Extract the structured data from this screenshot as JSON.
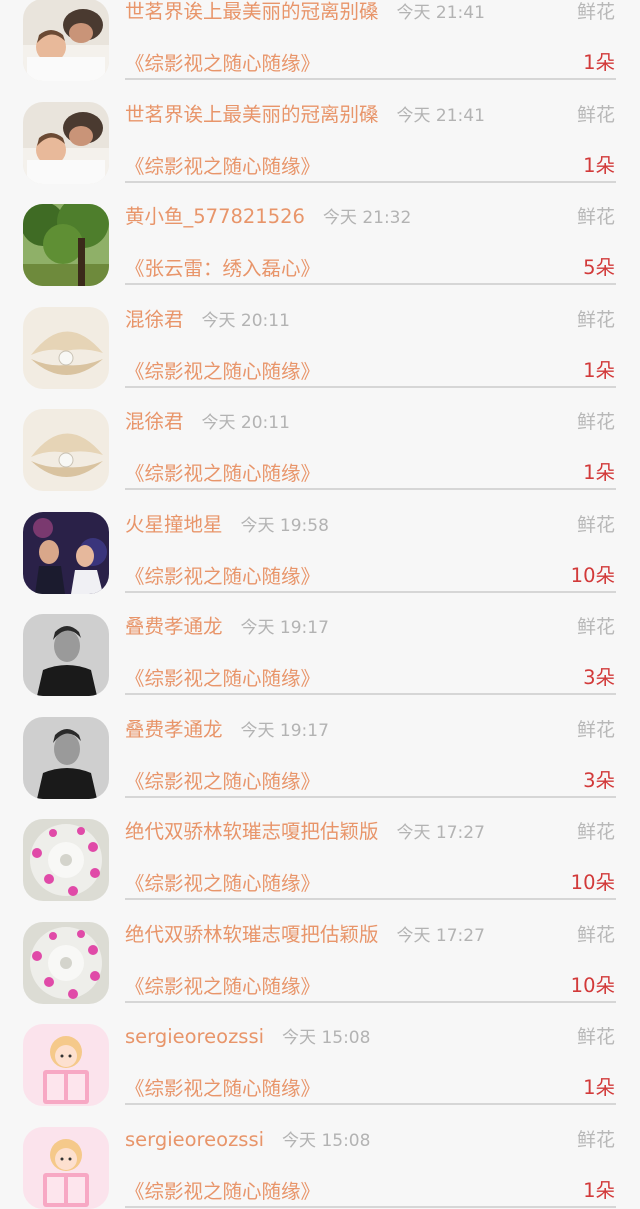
{
  "gifts": [
    {
      "user": "世茗界诶上最美丽的冠离别磉",
      "time": "今天 21:41",
      "gift": "鲜花",
      "book": "《综影视之随心随缘》",
      "count": "1朵",
      "avatar": "sleeping-baby-photo"
    },
    {
      "user": "世茗界诶上最美丽的冠离别磉",
      "time": "今天 21:41",
      "gift": "鲜花",
      "book": "《综影视之随心随缘》",
      "count": "1朵",
      "avatar": "sleeping-baby-photo"
    },
    {
      "user": "黄小鱼_577821526",
      "time": "今天 21:32",
      "gift": "鲜花",
      "book": "《张云雷：绣入磊心》",
      "count": "5朵",
      "avatar": "tree-photo"
    },
    {
      "user": "混徐君",
      "time": "今天 20:11",
      "gift": "鲜花",
      "book": "《综影视之随心随缘》",
      "count": "1朵",
      "avatar": "pearl-shell-photo"
    },
    {
      "user": "混徐君",
      "time": "今天 20:11",
      "gift": "鲜花",
      "book": "《综影视之随心随缘》",
      "count": "1朵",
      "avatar": "pearl-shell-photo"
    },
    {
      "user": "火星撞地星",
      "time": "今天 19:58",
      "gift": "鲜花",
      "book": "《综影视之随心随缘》",
      "count": "10朵",
      "avatar": "movie-scene-photo"
    },
    {
      "user": "叠费孝通龙",
      "time": "今天 19:17",
      "gift": "鲜花",
      "book": "《综影视之随心随缘》",
      "count": "3朵",
      "avatar": "man-portrait-bw-photo"
    },
    {
      "user": "叠费孝通龙",
      "time": "今天 19:17",
      "gift": "鲜花",
      "book": "《综影视之随心随缘》",
      "count": "3朵",
      "avatar": "man-portrait-bw-photo"
    },
    {
      "user": "绝代双骄林软璀志嗄把估颖版",
      "time": "今天 17:27",
      "gift": "鲜花",
      "book": "《综影视之随心随缘》",
      "count": "10朵",
      "avatar": "cactus-flower-photo"
    },
    {
      "user": "绝代双骄林软璀志嗄把估颖版",
      "time": "今天 17:27",
      "gift": "鲜花",
      "book": "《综影视之随心随缘》",
      "count": "10朵",
      "avatar": "cactus-flower-photo"
    },
    {
      "user": "sergieoreozssi",
      "time": "今天 15:08",
      "gift": "鲜花",
      "book": "《综影视之随心随缘》",
      "count": "1朵",
      "avatar": "cartoon-girl-book-illustration"
    },
    {
      "user": "sergieoreozssi",
      "time": "今天 15:08",
      "gift": "鲜花",
      "book": "《综影视之随心随缘》",
      "count": "1朵",
      "avatar": "cartoon-girl-book-illustration"
    }
  ]
}
